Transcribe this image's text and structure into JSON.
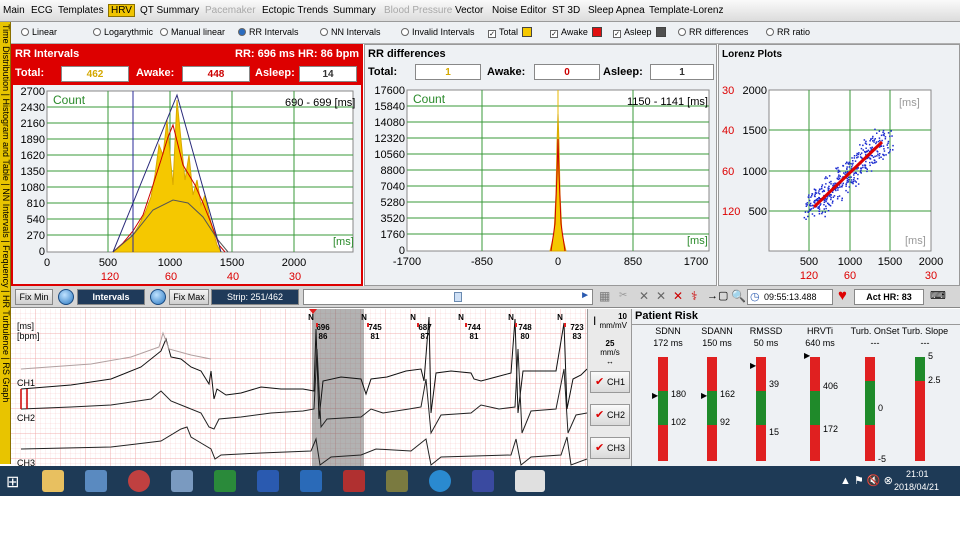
{
  "menu": {
    "items": [
      {
        "label": "Main",
        "state": "normal"
      },
      {
        "label": "ECG",
        "state": "normal"
      },
      {
        "label": "Templates",
        "state": "normal"
      },
      {
        "label": "HRV",
        "state": "active"
      },
      {
        "label": "QT Summary",
        "state": "normal"
      },
      {
        "label": "Pacemaker",
        "state": "disabled"
      },
      {
        "label": "Ectopic Trends",
        "state": "normal"
      },
      {
        "label": "Summary",
        "state": "normal"
      },
      {
        "label": "Blood Pressure",
        "state": "disabled"
      },
      {
        "label": "Vector",
        "state": "normal"
      },
      {
        "label": "Noise Editor",
        "state": "normal"
      },
      {
        "label": "ST 3D",
        "state": "normal"
      },
      {
        "label": "Sleep Apnea",
        "state": "normal"
      },
      {
        "label": "Template-Lorenz",
        "state": "normal"
      }
    ]
  },
  "side_tabs": "Time Distribution | Histogram and Table | NN Intervals | Frequency | HR Turbulence | RS Graph",
  "options": {
    "linear": "Linear",
    "logarithmic": "Logarythmic",
    "manual": "Manual linear",
    "rr_intervals": "RR Intervals",
    "nn_intervals": "NN Intervals",
    "invalid_intervals": "Invalid Intervals",
    "total": "Total",
    "awake": "Awake",
    "asleep": "Asleep",
    "rr_differences": "RR differences",
    "rr_ratio": "RR ratio",
    "total_color": "#f5c800",
    "awake_color": "#e01010",
    "asleep_color": "#505050"
  },
  "rr_panel": {
    "title": "RR Intervals",
    "summary": "RR: 696 ms  HR: 86 bpm",
    "total_label": "Total:",
    "total": "462",
    "awake_label": "Awake:",
    "awake": "448",
    "asleep_label": "Asleep:",
    "asleep": "14",
    "count_label": "Count",
    "range_label": "690 - 699 [ms]",
    "unit_label": "[ms]",
    "y_ticks": [
      "2700",
      "2430",
      "2160",
      "1890",
      "1620",
      "1350",
      "1080",
      "810",
      "540",
      "270",
      "0"
    ],
    "x_ticks": [
      "0",
      "500",
      "1000",
      "1500",
      "2000"
    ],
    "hr_ticks": [
      "120",
      "60",
      "40",
      "30"
    ]
  },
  "diff_panel": {
    "title": "RR differences",
    "total_label": "Total:",
    "total": "1",
    "awake_label": "Awake:",
    "awake": "0",
    "asleep_label": "Asleep:",
    "asleep": "1",
    "count_label": "Count",
    "range_label": "1150 - 1141 [ms]",
    "unit_label": "[ms]",
    "y_ticks": [
      "17600",
      "15840",
      "14080",
      "12320",
      "10560",
      "8800",
      "7040",
      "5280",
      "3520",
      "1760",
      "0"
    ],
    "x_ticks": [
      "-1700",
      "-850",
      "0",
      "850",
      "1700"
    ]
  },
  "lorenz_panel": {
    "title": "Lorenz Plots",
    "unit_label": "[ms]",
    "y_ticks": [
      "2000",
      "1500",
      "1000",
      "500"
    ],
    "hr_y_ticks": [
      "30",
      "40",
      "60",
      "120"
    ],
    "x_ticks": [
      "500",
      "1000",
      "1500",
      "2000"
    ],
    "hr_x_ticks": [
      "120",
      "60",
      "30"
    ]
  },
  "strip_toolbar": {
    "fix_min": "Fix Min",
    "intervals": "Intervals",
    "fix_max": "Fix Max",
    "strip": "Strip: 251/462",
    "time": "09:55:13.488",
    "act_hr": "Act HR: 83"
  },
  "ecg": {
    "y_unit_ms": "[ms]",
    "y_unit_bpm": "[bpm]",
    "channels": [
      "CH1",
      "CH2",
      "CH3"
    ],
    "beats": [
      {
        "type": "N",
        "rr": "696",
        "hr": "86"
      },
      {
        "type": "N",
        "rr": "745",
        "hr": "81"
      },
      {
        "type": "N",
        "rr": "687",
        "hr": "87"
      },
      {
        "type": "N",
        "rr": "744",
        "hr": "81"
      },
      {
        "type": "N",
        "rr": "748",
        "hr": "80"
      },
      {
        "type": "N",
        "rr": "723",
        "hr": "83"
      }
    ],
    "gain": "10",
    "gain_unit": "mm/mV",
    "speed": "25",
    "speed_unit": "mm/s"
  },
  "risk": {
    "title": "Patient Risk",
    "metrics": [
      {
        "name": "SDNN",
        "value": "172 ms",
        "upper": "180",
        "lower": "102"
      },
      {
        "name": "SDANN",
        "value": "150 ms",
        "upper": "162",
        "lower": "92"
      },
      {
        "name": "RMSSD",
        "value": "50 ms",
        "upper": "39",
        "lower": "15"
      },
      {
        "name": "HRVTi",
        "value": "640 ms",
        "upper": "406",
        "lower": "172"
      },
      {
        "name": "Turb. OnSet",
        "value": "---",
        "upper": "",
        "lower": "0",
        "bottom": "-5"
      },
      {
        "name": "Turb. Slope",
        "value": "---",
        "upper": "5",
        "lower": "2.5",
        "bottom": ""
      }
    ]
  },
  "taskbar": {
    "time": "21:01",
    "date": "2018/04/21"
  }
}
